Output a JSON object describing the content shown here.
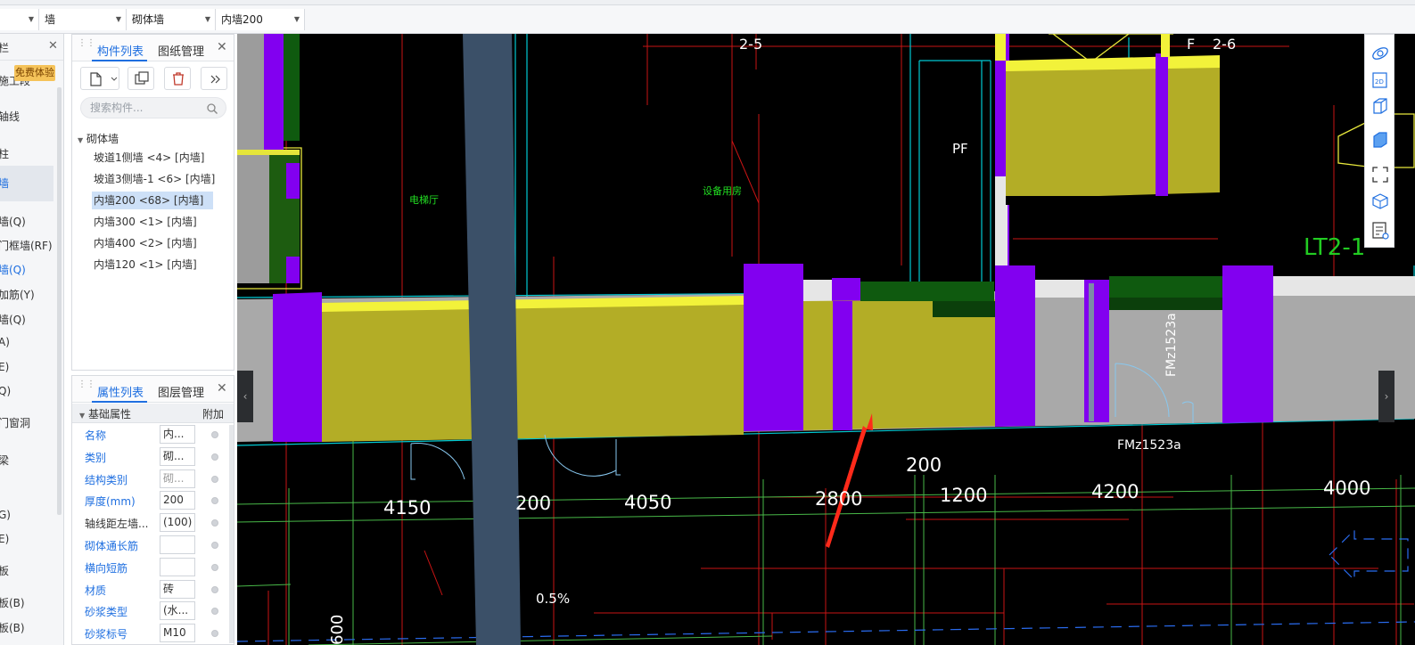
{
  "toolbar": {
    "combo1": "",
    "combo2": "墙",
    "combo3": "砌体墙",
    "combo4": "内墙200"
  },
  "leftnav": {
    "header": "栏",
    "promo": "免费体验",
    "items": [
      {
        "label": "施工段",
        "style": "normal"
      },
      {
        "label": "轴线",
        "style": "normal"
      },
      {
        "label": "柱",
        "style": "normal"
      },
      {
        "label": "墙",
        "style": "selected"
      },
      {
        "label": "墙(Q)",
        "style": "normal"
      },
      {
        "label": "门框墙(RF)",
        "style": "normal"
      },
      {
        "label": "墙(Q)",
        "style": "highlight"
      },
      {
        "label": "加筋(Y)",
        "style": "normal"
      },
      {
        "label": "墙(Q)",
        "style": "normal"
      },
      {
        "label": "A)",
        "style": "normal"
      },
      {
        "label": "E)",
        "style": "normal"
      },
      {
        "label": "Q)",
        "style": "normal"
      },
      {
        "label": "门窗洞",
        "style": "normal"
      },
      {
        "label": "梁",
        "style": "normal"
      },
      {
        "label": "G)",
        "style": "normal"
      },
      {
        "label": "E)",
        "style": "normal"
      },
      {
        "label": "板",
        "style": "normal"
      },
      {
        "label": "板(B)",
        "style": "normal"
      },
      {
        "label": "板(B)",
        "style": "normal"
      }
    ]
  },
  "component_panel": {
    "tab_active": "构件列表",
    "tab_other": "图纸管理",
    "search_placeholder": "搜索构件...",
    "group": "砌体墙",
    "items": [
      {
        "label": "坡道1侧墙 <4> [内墙]",
        "selected": false
      },
      {
        "label": "坡道3侧墙-1 <6> [内墙]",
        "selected": false
      },
      {
        "label": "内墙200 <68> [内墙]",
        "selected": true
      },
      {
        "label": "内墙300 <1> [内墙]",
        "selected": false
      },
      {
        "label": "内墙400 <2> [内墙]",
        "selected": false
      },
      {
        "label": "内墙120 <1> [内墙]",
        "selected": false
      }
    ]
  },
  "property_panel": {
    "tab_active": "属性列表",
    "tab_other": "图层管理",
    "section": "基础属性",
    "section_right": "附加",
    "rows": [
      {
        "label": "名称",
        "value": "内...",
        "label_blue": true,
        "value_gray": false
      },
      {
        "label": "类别",
        "value": "砌...",
        "label_blue": true,
        "value_gray": false
      },
      {
        "label": "结构类别",
        "value": "砌...",
        "label_blue": true,
        "value_gray": true
      },
      {
        "label": "厚度(mm)",
        "value": "200",
        "label_blue": true,
        "value_gray": false
      },
      {
        "label": "轴线距左墙...",
        "value": "(100)",
        "label_blue": false,
        "value_gray": false
      },
      {
        "label": "砌体通长筋",
        "value": "",
        "label_blue": true,
        "value_gray": false
      },
      {
        "label": "横向短筋",
        "value": "",
        "label_blue": true,
        "value_gray": false
      },
      {
        "label": "材质",
        "value": "砖",
        "label_blue": true,
        "value_gray": false
      },
      {
        "label": "砂浆类型",
        "value": "(水...",
        "label_blue": true,
        "value_gray": false
      },
      {
        "label": "砂浆标号",
        "value": "M10",
        "label_blue": true,
        "value_gray": false
      }
    ]
  },
  "canvas": {
    "axis_labels": [
      "2-5",
      "2-6",
      "F"
    ],
    "room_labels": [
      "电梯厅",
      "设备用房"
    ],
    "tags": [
      "PF",
      "LT2-1",
      "FMz1523a",
      "FMz1523a"
    ],
    "dimensions": [
      "4150",
      "200",
      "4050",
      "2800",
      "1200",
      "4200",
      "4000",
      "200"
    ],
    "slope": "0.5%",
    "bottom_dim": "600"
  },
  "colors": {
    "wall_yellow": "#b3ad26",
    "column_purple": "#8200f0",
    "accent_blue": "#1f6fe0"
  }
}
